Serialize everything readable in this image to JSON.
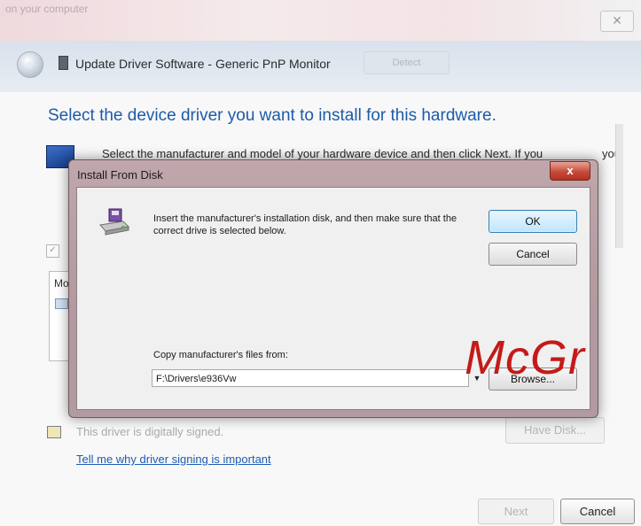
{
  "window": {
    "cut_text": "on your computer",
    "close_glyph": "✕"
  },
  "header": {
    "title": "Update Driver Software - Generic PnP Monitor",
    "ghost_button": "Detect"
  },
  "main": {
    "heading": "Select the device driver you want to install for this hardware.",
    "description": "Select the manufacturer and model of your hardware device and then click Next. If you",
    "description_tail": "you",
    "list_label": "Mo",
    "signed_text": "This driver is digitally signed.",
    "signing_link": "Tell me why driver signing is important",
    "have_disk_button": "Have Disk...",
    "next_button": "Next",
    "cancel_button": "Cancel"
  },
  "dialog": {
    "title": "Install From Disk",
    "close_glyph": "x",
    "message": "Insert the manufacturer's installation disk, and then make sure that the correct drive is selected below.",
    "ok_button": "OK",
    "cancel_button": "Cancel",
    "copy_label": "Copy manufacturer's files from:",
    "path_value": "F:\\Drivers\\e936Vw",
    "browse_button": "Browse..."
  },
  "watermark": {
    "text": "McGr",
    "color": "#c41a1a"
  },
  "colors": {
    "heading_blue": "#1d5ba8",
    "link_blue": "#1e5cb3",
    "dialog_frame": "#b59aa0"
  }
}
